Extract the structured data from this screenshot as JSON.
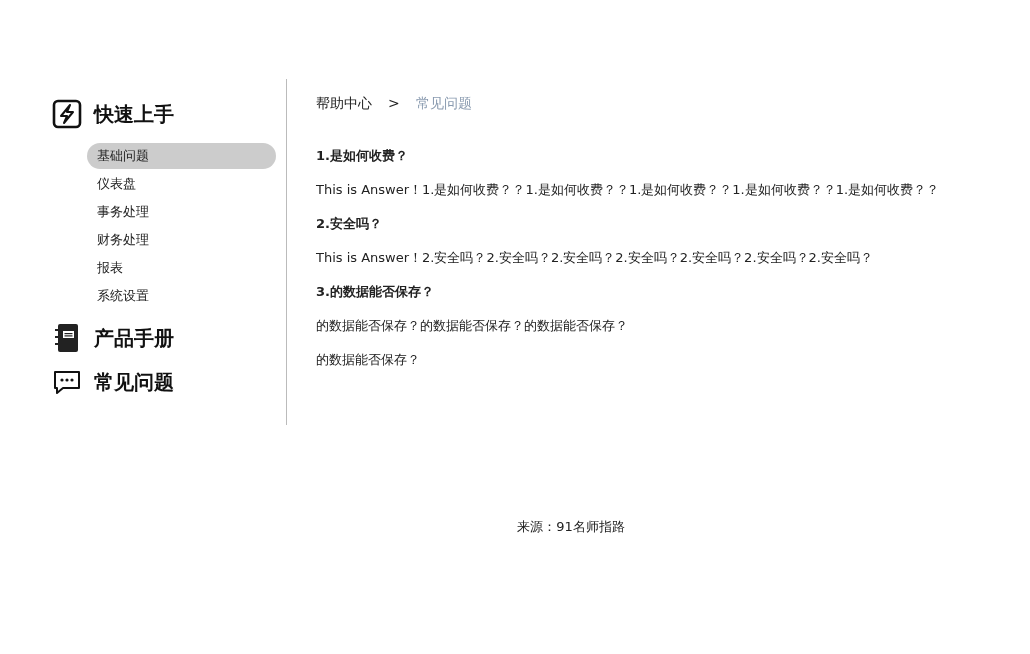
{
  "sidebar": {
    "sections": [
      {
        "title": "快速上手",
        "items": [
          {
            "label": "基础问题",
            "selected": true
          },
          {
            "label": "仪表盘",
            "selected": false
          },
          {
            "label": "事务处理",
            "selected": false
          },
          {
            "label": "财务处理",
            "selected": false
          },
          {
            "label": "报表",
            "selected": false
          },
          {
            "label": "系统设置",
            "selected": false
          }
        ]
      },
      {
        "title": "产品手册"
      },
      {
        "title": "常见问题"
      }
    ]
  },
  "breadcrumb": [
    {
      "label": "帮助中心",
      "current": false
    },
    {
      "label": "常见问题",
      "current": true
    }
  ],
  "breadcrumb_separator": ">",
  "faq": [
    {
      "question": "1.是如何收费？",
      "answer": [
        "This is Answer！1.是如何收费？？1.是如何收费？？1.是如何收费？？1.是如何收费？？1.是如何收费？？"
      ]
    },
    {
      "question": "2.安全吗？",
      "answer": [
        "This is Answer！2.安全吗？2.安全吗？2.安全吗？2.安全吗？2.安全吗？2.安全吗？2.安全吗？"
      ]
    },
    {
      "question": "3.的数据能否保存？",
      "answer": [
        "的数据能否保存？的数据能否保存？的数据能否保存？",
        "的数据能否保存？"
      ]
    }
  ],
  "footer": "来源：91名师指路"
}
